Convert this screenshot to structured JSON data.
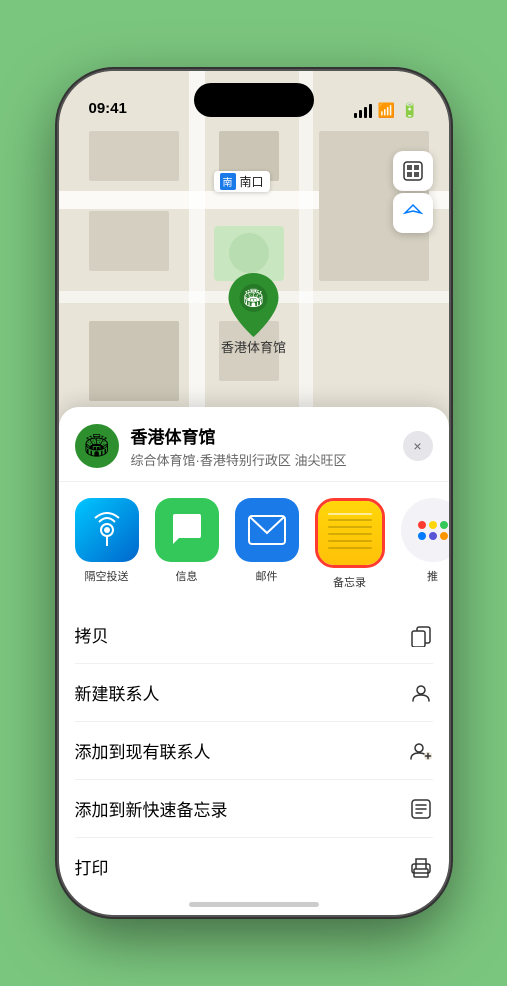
{
  "phone": {
    "status_bar": {
      "time": "09:41",
      "location_arrow": "▶"
    }
  },
  "map": {
    "label": "南口",
    "label_prefix": "南口"
  },
  "marker": {
    "name": "香港体育馆",
    "icon": "🏟"
  },
  "location_header": {
    "name": "香港体育馆",
    "description": "综合体育馆·香港特别行政区 油尖旺区",
    "close_label": "×"
  },
  "share_items": [
    {
      "id": "airdrop",
      "label": "隔空投送",
      "type": "airdrop"
    },
    {
      "id": "messages",
      "label": "信息",
      "type": "messages"
    },
    {
      "id": "mail",
      "label": "邮件",
      "type": "mail"
    },
    {
      "id": "notes",
      "label": "备忘录",
      "type": "notes",
      "selected": true
    }
  ],
  "more": {
    "label": "推",
    "dots": {
      "colors": [
        "#ff3b30",
        "#ffd60a",
        "#34c759",
        "#007aff",
        "#5856d6",
        "#ff9500"
      ]
    }
  },
  "actions": [
    {
      "id": "copy",
      "label": "拷贝",
      "icon": "⎘"
    },
    {
      "id": "add-contact",
      "label": "新建联系人",
      "icon": "👤"
    },
    {
      "id": "add-existing",
      "label": "添加到现有联系人",
      "icon": "👤"
    },
    {
      "id": "quick-note",
      "label": "添加到新快速备忘录",
      "icon": "⬛"
    },
    {
      "id": "print",
      "label": "打印",
      "icon": "🖨"
    }
  ]
}
